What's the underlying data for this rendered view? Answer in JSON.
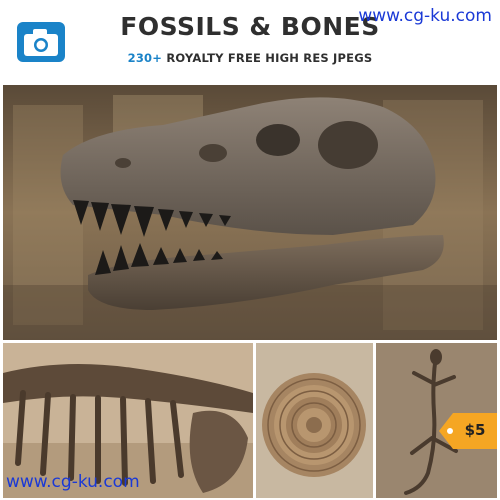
{
  "header": {
    "title": "FOSSILS & BONES",
    "subtitle_count": "230+",
    "subtitle_rest": " ROYALTY FREE HIGH RES JPEGS",
    "icon": "camera-icon"
  },
  "watermarks": {
    "top": "www.cg-ku.com",
    "bottom": "www.cg-ku.com"
  },
  "price": {
    "label": "$5"
  },
  "images": [
    {
      "name": "t-rex skull",
      "icon": "t-rex-skull-image"
    },
    {
      "name": "dinosaur skeleton",
      "icon": "skeleton-image"
    },
    {
      "name": "ammonite",
      "icon": "ammonite-image"
    },
    {
      "name": "lizard fossil",
      "icon": "lizard-fossil-image"
    }
  ],
  "colors": {
    "accent": "#1a83c8",
    "watermark": "#1a39d6",
    "price_tag": "#f5a623"
  }
}
